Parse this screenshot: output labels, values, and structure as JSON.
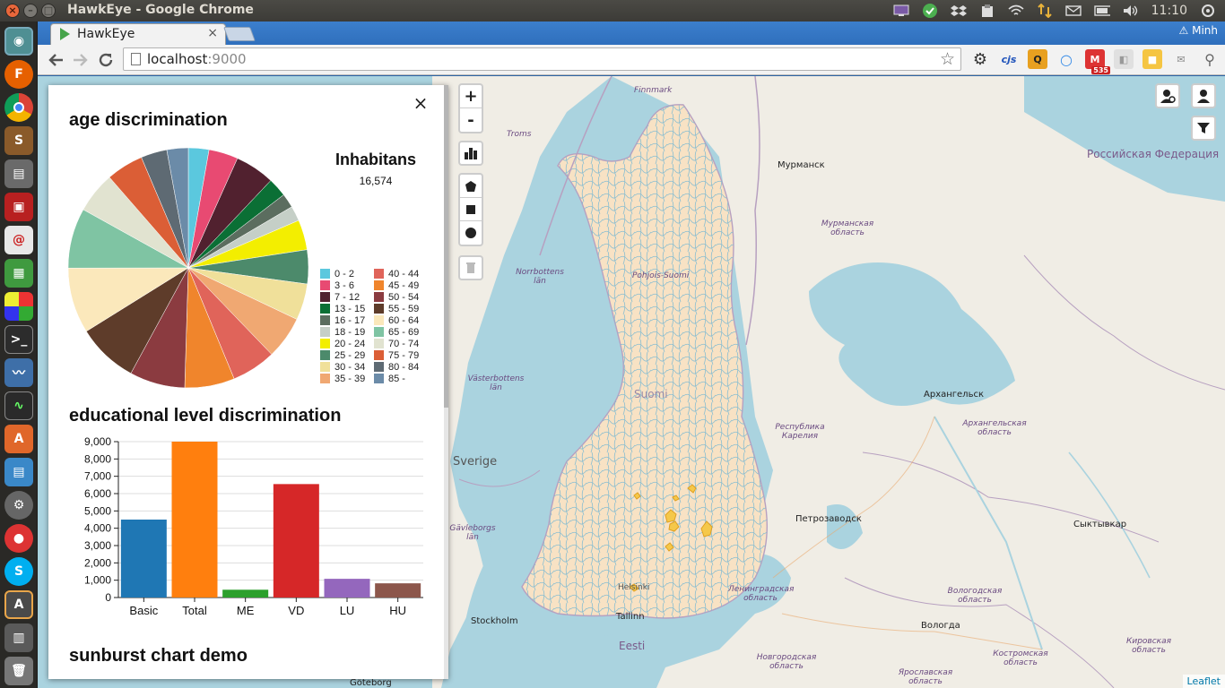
{
  "os": {
    "window_title": "HawkEye - Google Chrome",
    "clock": "11:10",
    "user": "Minh",
    "mail_count": "535"
  },
  "browser": {
    "tab_title": "HawkEye",
    "url_host": "localhost",
    "url_port": ":9000",
    "ext_cjs_label": "cjs"
  },
  "panel": {
    "age_title": "age discrimination",
    "inhabitants_label": "Inhabitans",
    "inhabitants_value": "16,574",
    "edu_title": "educational level discrimination",
    "sunburst_title": "sunburst chart demo",
    "close_symbol": "×"
  },
  "map": {
    "zoom_in": "+",
    "zoom_out": "-",
    "attribution": "Leaflet",
    "labels": [
      {
        "text": "Finnmark",
        "kind": "place"
      },
      {
        "text": "Troms",
        "kind": "place"
      },
      {
        "text": "Мурманск",
        "kind": "city"
      },
      {
        "text": "Российская Федерация",
        "kind": "country"
      },
      {
        "text": "Мурманская область",
        "kind": "place"
      },
      {
        "text": "Norrbottens län",
        "kind": "place"
      },
      {
        "text": "Pohjois-Suomi",
        "kind": "place"
      },
      {
        "text": "Västerbottens län",
        "kind": "place"
      },
      {
        "text": "Suomi",
        "kind": "country"
      },
      {
        "text": "Архангельск",
        "kind": "city"
      },
      {
        "text": "Республика Карелия",
        "kind": "place"
      },
      {
        "text": "Архангельская область",
        "kind": "place"
      },
      {
        "text": "Sverige",
        "kind": "country"
      },
      {
        "text": "Петрозаводск",
        "kind": "city"
      },
      {
        "text": "Сыктывкар",
        "kind": "city"
      },
      {
        "text": "Gävleborgs län",
        "kind": "place"
      },
      {
        "text": "Helsinki",
        "kind": "city"
      },
      {
        "text": "Ленинградская область",
        "kind": "place"
      },
      {
        "text": "Вологодская область",
        "kind": "place"
      },
      {
        "text": "Stockholm",
        "kind": "city"
      },
      {
        "text": "Tallinn",
        "kind": "city"
      },
      {
        "text": "Вологда",
        "kind": "city"
      },
      {
        "text": "Eesti",
        "kind": "country"
      },
      {
        "text": "Новгородская область",
        "kind": "place"
      },
      {
        "text": "Костромская область",
        "kind": "place"
      },
      {
        "text": "Кировская область",
        "kind": "place"
      },
      {
        "text": "Ярославская область",
        "kind": "place"
      },
      {
        "text": "Göteborg",
        "kind": "city"
      }
    ]
  },
  "chart_data": [
    {
      "type": "pie",
      "title": "age discrimination",
      "categories": [
        "0 - 2",
        "3 - 6",
        "7 - 12",
        "13 - 15",
        "16 - 17",
        "18 - 19",
        "20 - 24",
        "25 - 29",
        "30 - 34",
        "35 - 39",
        "40 - 44",
        "45 - 49",
        "50 - 54",
        "55 - 59",
        "60 - 64",
        "65 - 69",
        "70 - 74",
        "75 - 79",
        "80 - 84",
        "85 -"
      ],
      "values": [
        2.6,
        3.7,
        5.0,
        2.4,
        1.8,
        1.9,
        3.8,
        4.3,
        4.6,
        5.4,
        5.6,
        6.3,
        7.0,
        7.7,
        8.3,
        7.6,
        5.2,
        4.7,
        3.3,
        2.7
      ],
      "colors": [
        "#5bc8de",
        "#e84a72",
        "#51212f",
        "#0b6f35",
        "#5b6d5f",
        "#c5cfc7",
        "#f3ee00",
        "#4c8a6b",
        "#f0e09a",
        "#f0a872",
        "#e0645a",
        "#f0852c",
        "#8b3b40",
        "#5e3c2a",
        "#fbe8bb",
        "#7fc4a3",
        "#e1e3d0",
        "#db5e36",
        "#5e6a73",
        "#6b8ba8"
      ],
      "legend_position": "right"
    },
    {
      "type": "bar",
      "title": "educational level discrimination",
      "categories": [
        "Basic",
        "Total",
        "ME",
        "VD",
        "LU",
        "HU"
      ],
      "values": [
        4500,
        9000,
        450,
        6550,
        1080,
        820
      ],
      "colors": [
        "#1f77b4",
        "#ff7f0e",
        "#2ca02c",
        "#d62728",
        "#9467bd",
        "#8c564b"
      ],
      "ylim": [
        0,
        9000
      ],
      "yticks": [
        "0",
        "1,000",
        "2,000",
        "3,000",
        "4,000",
        "5,000",
        "6,000",
        "7,000",
        "8,000",
        "9,000"
      ],
      "grid": true
    }
  ]
}
